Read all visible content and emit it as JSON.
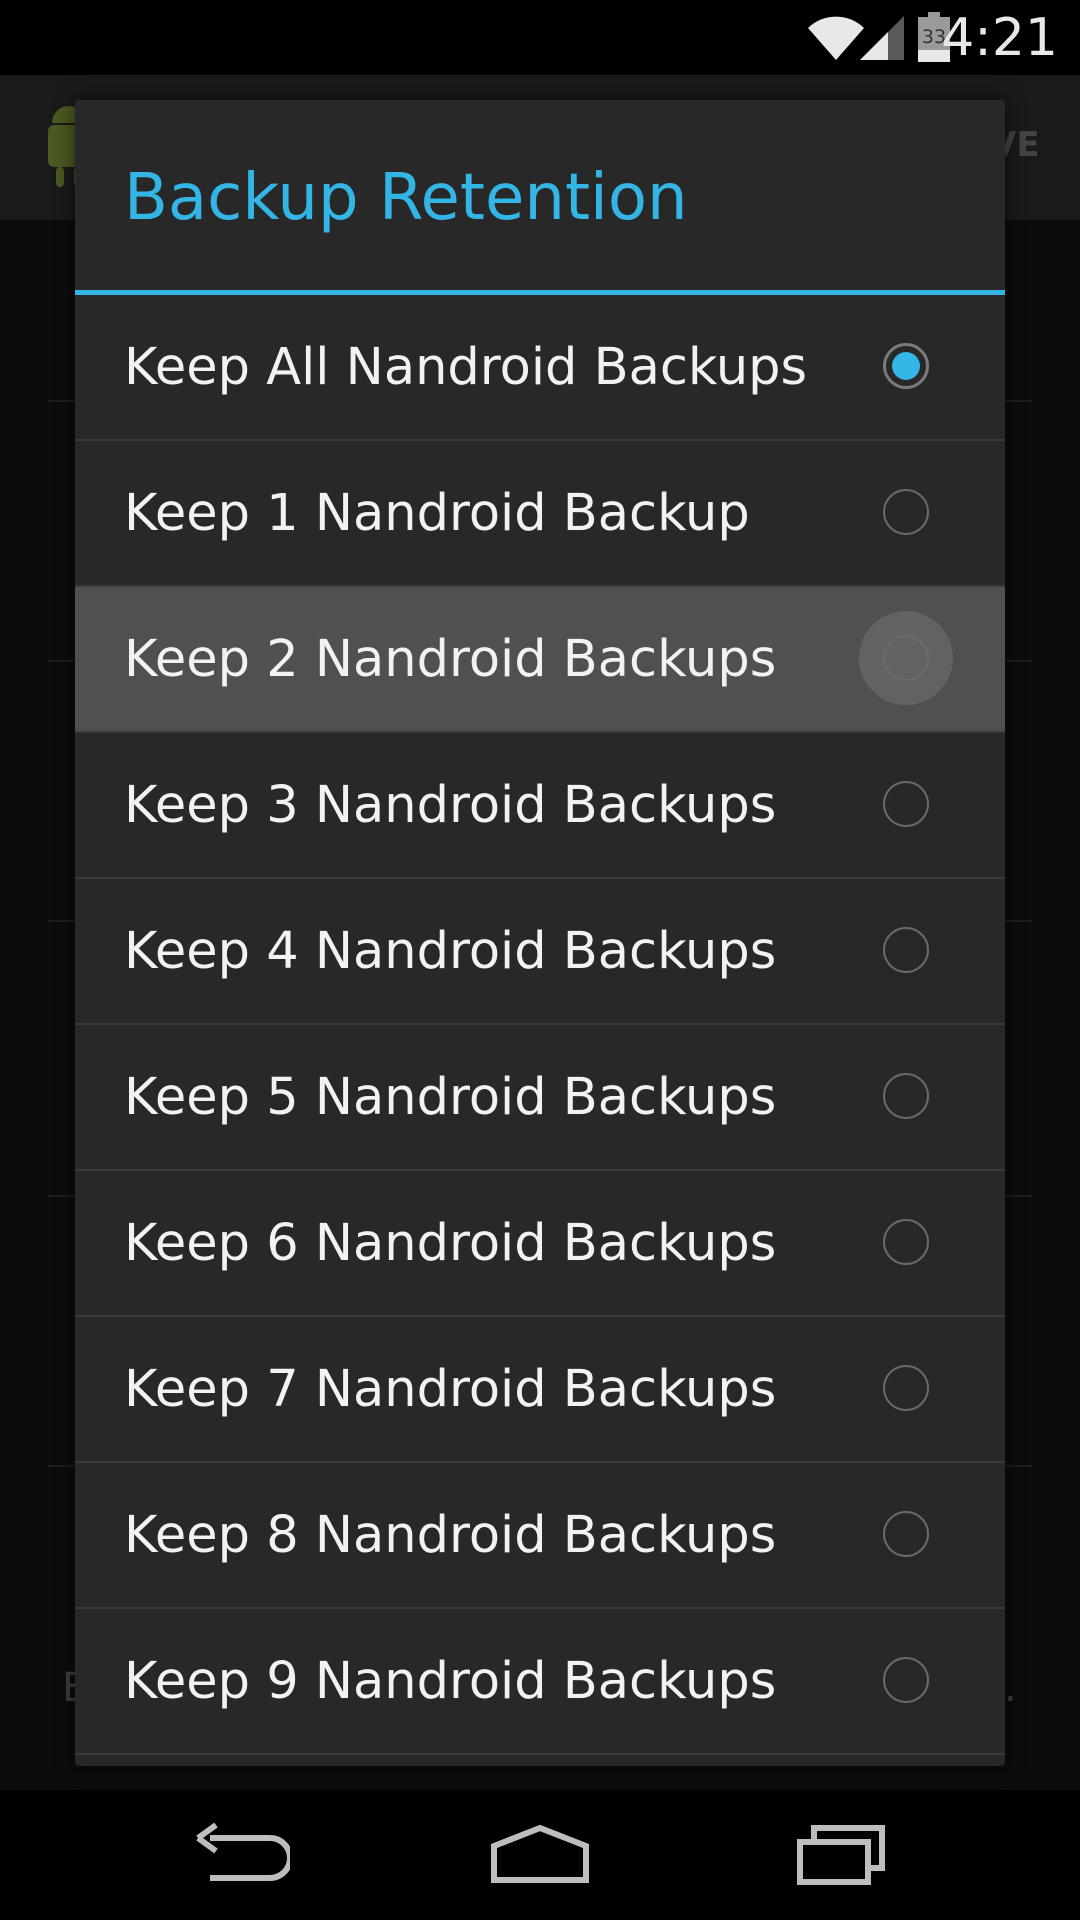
{
  "status_bar": {
    "time": "4:21",
    "battery_level": "33",
    "icons": [
      "wifi-icon",
      "signal-icon",
      "battery-icon"
    ]
  },
  "background_app": {
    "action_label": "VE",
    "edge_text_left": "E",
    "edge_text_right": "."
  },
  "dialog": {
    "title": "Backup Retention",
    "accent_color": "#33b5e5",
    "selected_index": 0,
    "pressed_index": 2,
    "options": [
      {
        "label": "Keep All Nandroid Backups",
        "checked": true
      },
      {
        "label": "Keep 1 Nandroid Backup",
        "checked": false
      },
      {
        "label": "Keep 2 Nandroid Backups",
        "checked": false
      },
      {
        "label": "Keep 3 Nandroid Backups",
        "checked": false
      },
      {
        "label": "Keep 4 Nandroid Backups",
        "checked": false
      },
      {
        "label": "Keep 5 Nandroid Backups",
        "checked": false
      },
      {
        "label": "Keep 6 Nandroid Backups",
        "checked": false
      },
      {
        "label": "Keep 7 Nandroid Backups",
        "checked": false
      },
      {
        "label": "Keep 8 Nandroid Backups",
        "checked": false
      },
      {
        "label": "Keep 9 Nandroid Backups",
        "checked": false
      }
    ]
  },
  "nav_bar": {
    "buttons": [
      "back-icon",
      "home-icon",
      "recent-apps-icon"
    ]
  }
}
